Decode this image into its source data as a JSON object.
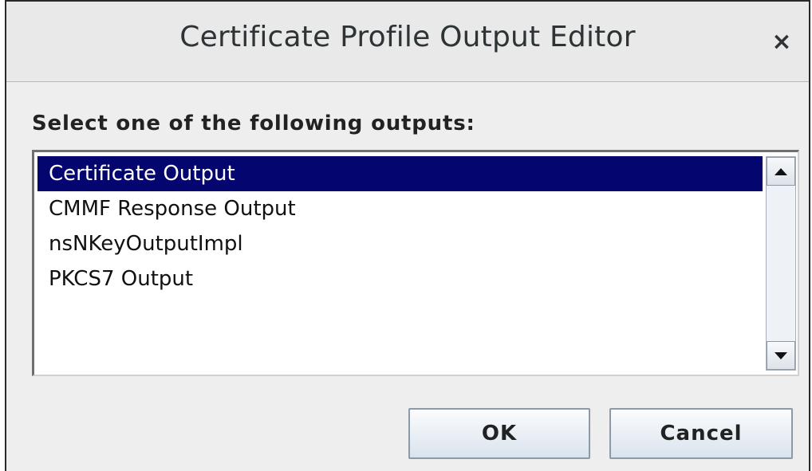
{
  "dialog": {
    "title": "Certificate Profile Output Editor",
    "close_glyph": "×",
    "prompt": "Select one of the following outputs:"
  },
  "outputs": {
    "items": [
      {
        "label": "Certificate Output",
        "selected": true
      },
      {
        "label": "CMMF Response Output",
        "selected": false
      },
      {
        "label": "nsNKeyOutputImpl",
        "selected": false
      },
      {
        "label": "PKCS7 Output",
        "selected": false
      }
    ]
  },
  "buttons": {
    "ok_label": "OK",
    "cancel_label": "Cancel"
  },
  "colors": {
    "selection": "#050570",
    "window_bg": "#eeeeee"
  }
}
